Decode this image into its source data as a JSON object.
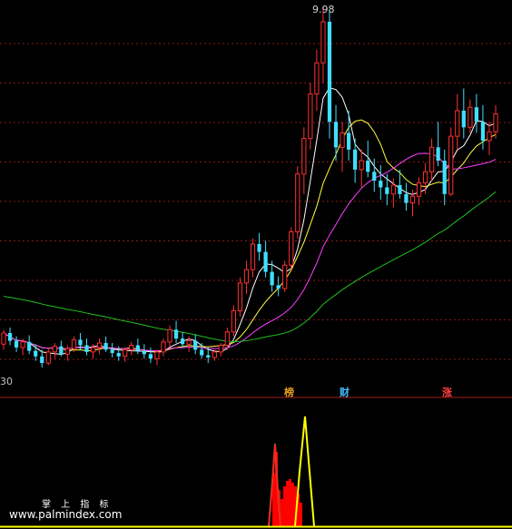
{
  "chart_data": {
    "type": "candlestick",
    "price_panel": {
      "high_label": "9.98",
      "low_label": "30",
      "gridlines_dashed": true,
      "colors": {
        "up": "#ff3030",
        "down": "#40e0ff",
        "ma_short": "#ffffff",
        "ma_mid": "#ffff40",
        "ma_long": "#ff40ff",
        "ma_slow": "#20c020"
      },
      "candles": [
        [
          6.95,
          7.08,
          6.9,
          7.05
        ],
        [
          7.05,
          7.1,
          6.94,
          6.98
        ],
        [
          6.98,
          7.02,
          6.88,
          6.92
        ],
        [
          6.92,
          7.0,
          6.85,
          6.97
        ],
        [
          6.97,
          7.03,
          6.86,
          6.89
        ],
        [
          6.89,
          6.95,
          6.8,
          6.84
        ],
        [
          6.84,
          6.9,
          6.74,
          6.78
        ],
        [
          6.78,
          6.92,
          6.76,
          6.88
        ],
        [
          6.88,
          6.96,
          6.82,
          6.93
        ],
        [
          6.93,
          6.98,
          6.84,
          6.86
        ],
        [
          6.86,
          6.94,
          6.8,
          6.91
        ],
        [
          6.91,
          7.02,
          6.88,
          6.99
        ],
        [
          6.99,
          7.05,
          6.9,
          6.94
        ],
        [
          6.94,
          7.0,
          6.85,
          6.88
        ],
        [
          6.88,
          6.95,
          6.82,
          6.92
        ],
        [
          6.92,
          7.0,
          6.86,
          6.96
        ],
        [
          6.96,
          7.02,
          6.88,
          6.9
        ],
        [
          6.9,
          6.96,
          6.83,
          6.87
        ],
        [
          6.87,
          6.93,
          6.8,
          6.84
        ],
        [
          6.84,
          6.92,
          6.79,
          6.9
        ],
        [
          6.9,
          6.97,
          6.85,
          6.94
        ],
        [
          6.94,
          7.0,
          6.86,
          6.89
        ],
        [
          6.89,
          6.95,
          6.82,
          6.86
        ],
        [
          6.86,
          6.92,
          6.78,
          6.82
        ],
        [
          6.82,
          6.9,
          6.76,
          6.88
        ],
        [
          6.88,
          7.0,
          6.84,
          6.97
        ],
        [
          6.97,
          7.12,
          6.93,
          7.08
        ],
        [
          7.08,
          7.16,
          6.96,
          7.0
        ],
        [
          7.0,
          7.06,
          6.92,
          6.95
        ],
        [
          6.95,
          7.02,
          6.88,
          6.98
        ],
        [
          6.98,
          7.04,
          6.86,
          6.9
        ],
        [
          6.9,
          6.96,
          6.82,
          6.85
        ],
        [
          6.85,
          6.92,
          6.78,
          6.83
        ],
        [
          6.83,
          6.9,
          6.8,
          6.88
        ],
        [
          6.88,
          6.96,
          6.84,
          6.94
        ],
        [
          6.94,
          7.1,
          6.9,
          7.06
        ],
        [
          7.06,
          7.3,
          7.02,
          7.25
        ],
        [
          7.25,
          7.55,
          7.2,
          7.5
        ],
        [
          7.5,
          7.7,
          7.4,
          7.62
        ],
        [
          7.62,
          7.9,
          7.55,
          7.85
        ],
        [
          7.85,
          7.95,
          7.7,
          7.78
        ],
        [
          7.78,
          7.88,
          7.55,
          7.6
        ],
        [
          7.6,
          7.7,
          7.42,
          7.48
        ],
        [
          7.48,
          7.56,
          7.38,
          7.45
        ],
        [
          7.45,
          7.7,
          7.42,
          7.66
        ],
        [
          7.66,
          8.0,
          7.62,
          7.96
        ],
        [
          7.96,
          8.55,
          7.9,
          8.48
        ],
        [
          8.48,
          8.9,
          8.3,
          8.8
        ],
        [
          8.8,
          9.3,
          8.7,
          9.2
        ],
        [
          9.2,
          9.6,
          9.05,
          9.48
        ],
        [
          9.48,
          9.98,
          9.3,
          9.85
        ],
        [
          9.85,
          9.95,
          8.8,
          8.95
        ],
        [
          8.95,
          9.1,
          8.6,
          8.72
        ],
        [
          8.72,
          8.95,
          8.5,
          8.85
        ],
        [
          8.85,
          9.05,
          8.6,
          8.7
        ],
        [
          8.7,
          8.8,
          8.4,
          8.52
        ],
        [
          8.52,
          8.7,
          8.36,
          8.6
        ],
        [
          8.6,
          8.78,
          8.45,
          8.5
        ],
        [
          8.5,
          8.62,
          8.32,
          8.42
        ],
        [
          8.42,
          8.56,
          8.25,
          8.36
        ],
        [
          8.36,
          8.48,
          8.2,
          8.3
        ],
        [
          8.3,
          8.44,
          8.18,
          8.38
        ],
        [
          8.38,
          8.52,
          8.26,
          8.3
        ],
        [
          8.3,
          8.4,
          8.15,
          8.22
        ],
        [
          8.22,
          8.34,
          8.1,
          8.28
        ],
        [
          8.28,
          8.45,
          8.2,
          8.4
        ],
        [
          8.4,
          8.58,
          8.3,
          8.5
        ],
        [
          8.5,
          8.8,
          8.42,
          8.72
        ],
        [
          8.72,
          8.95,
          8.55,
          8.6
        ],
        [
          8.6,
          8.7,
          8.2,
          8.3
        ],
        [
          8.3,
          8.9,
          8.28,
          8.82
        ],
        [
          8.82,
          9.2,
          8.7,
          9.05
        ],
        [
          9.05,
          9.25,
          8.8,
          8.9
        ],
        [
          8.9,
          9.15,
          8.85,
          9.08
        ],
        [
          9.08,
          9.2,
          8.85,
          8.95
        ],
        [
          8.95,
          9.1,
          8.7,
          8.78
        ],
        [
          8.78,
          8.95,
          8.65,
          8.86
        ],
        [
          8.86,
          9.1,
          8.8,
          9.02
        ]
      ]
    },
    "indicator_panel": {
      "signals": [
        "榜",
        "财",
        "涨"
      ],
      "colors": {
        "fill": "#ff0000",
        "line_green": "#20a020",
        "line_yellow": "#ffff00"
      }
    }
  },
  "brand": "掌 上 指 标",
  "watermark": "www.palmindex.com"
}
